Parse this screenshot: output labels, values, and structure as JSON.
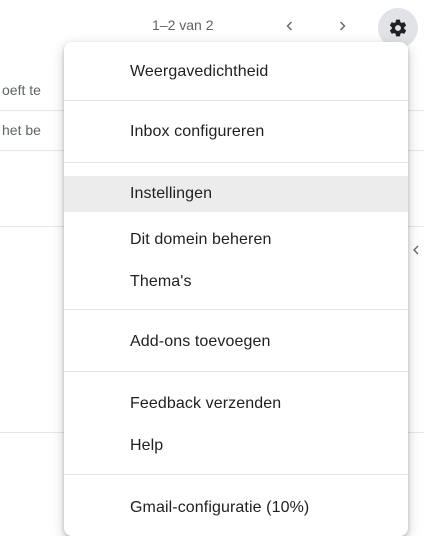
{
  "toolbar": {
    "page_range": "1–2 van 2"
  },
  "background_list": {
    "rows": [
      {
        "text": "oeft te"
      },
      {
        "text": "het be"
      }
    ]
  },
  "settings_menu": {
    "items": [
      {
        "label": "Weergavedichtheid"
      },
      {
        "label": "Inbox configureren"
      },
      {
        "label": "Instellingen"
      },
      {
        "label": "Dit domein beheren"
      },
      {
        "label": "Thema's"
      },
      {
        "label": "Add-ons toevoegen"
      },
      {
        "label": "Feedback verzenden"
      },
      {
        "label": "Help"
      },
      {
        "label": "Gmail-configuratie (10%)"
      }
    ],
    "highlighted_item": "Instellingen"
  },
  "colors": {
    "menu_background": "#ffffff",
    "highlight": "#ececec",
    "settings_button_bg": "#e1e3e6",
    "text_primary": "#202124",
    "text_secondary": "#5f6368"
  },
  "icons": {
    "prev": "chevron-left-icon",
    "next": "chevron-right-icon",
    "settings": "gear-icon"
  }
}
